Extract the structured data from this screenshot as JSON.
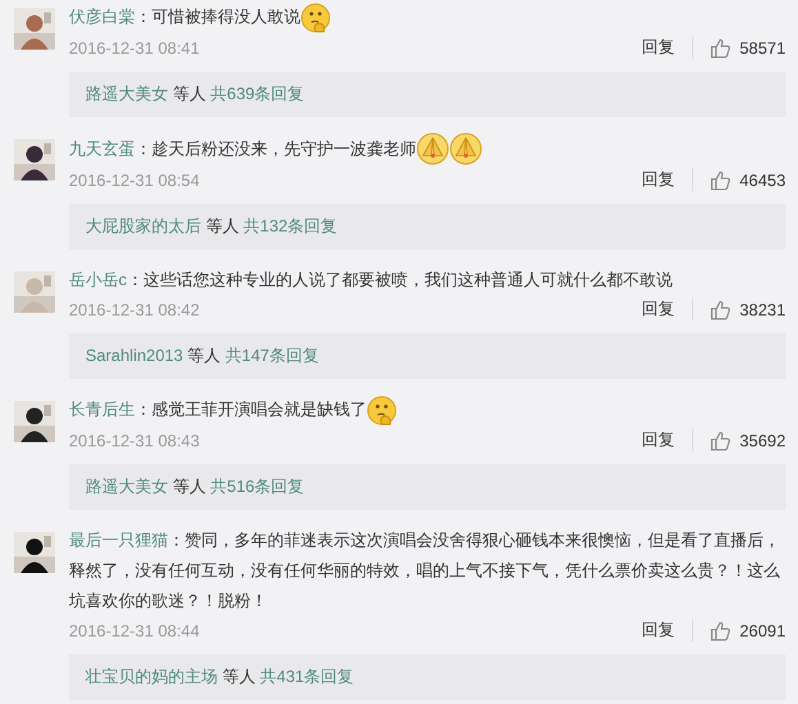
{
  "comments": [
    {
      "user": "伏彦白棠",
      "text": "：可惜被捧得没人敢说",
      "emojis": [
        {
          "kind": "thinking"
        }
      ],
      "time": "2016-12-31 08:41",
      "reply_button": "回复",
      "likes": "58571",
      "replies": {
        "users": "路遥大美女",
        "joiner": "等人",
        "count": "共639条回复"
      },
      "avatar": {
        "kind": "picture"
      }
    },
    {
      "user": "九天玄蛋",
      "text": "：趁天后粉还没来，先守护一波龚老师",
      "emojis": [
        {
          "kind": "pray"
        },
        {
          "kind": "pray"
        }
      ],
      "time": "2016-12-31 08:54",
      "reply_button": "回复",
      "likes": "46453",
      "replies": {
        "users": "大屁股家的太后",
        "joiner": "等人",
        "count": "共132条回复"
      },
      "avatar": {
        "kind": "picture"
      }
    },
    {
      "user": "岳小岳c",
      "text": "：这些话您这种专业的人说了都要被喷，我们这种普通人可就什么都不敢说",
      "time": "2016-12-31 08:42",
      "reply_button": "回复",
      "likes": "38231",
      "replies": {
        "users": "Sarahlin2013",
        "joiner": "等人",
        "count": "共147条回复"
      },
      "avatar": {
        "kind": "picture"
      }
    },
    {
      "user": "长青后生",
      "text": "：感觉王菲开演唱会就是缺钱了",
      "emojis": [
        {
          "kind": "thinking"
        }
      ],
      "time": "2016-12-31 08:43",
      "reply_button": "回复",
      "likes": "35692",
      "replies": {
        "users": "路遥大美女",
        "joiner": "等人",
        "count": "共516条回复"
      },
      "avatar": {
        "kind": "picture"
      }
    },
    {
      "user": "最后一只狸猫",
      "text": "：赞同，多年的菲迷表示这次演唱会没舍得狠心砸钱本来很懊恼，但是看了直播后，释然了，没有任何互动，没有任何华丽的特效，唱的上气不接下气，凭什么票价卖这么贵？！这么坑喜欢你的歌迷？！脱粉！",
      "time": "2016-12-31 08:44",
      "reply_button": "回复",
      "likes": "26091",
      "replies": {
        "users": "壮宝贝的妈的主场",
        "joiner": "等人",
        "count": "共431条回复"
      },
      "avatar": {
        "kind": "picture"
      }
    }
  ]
}
